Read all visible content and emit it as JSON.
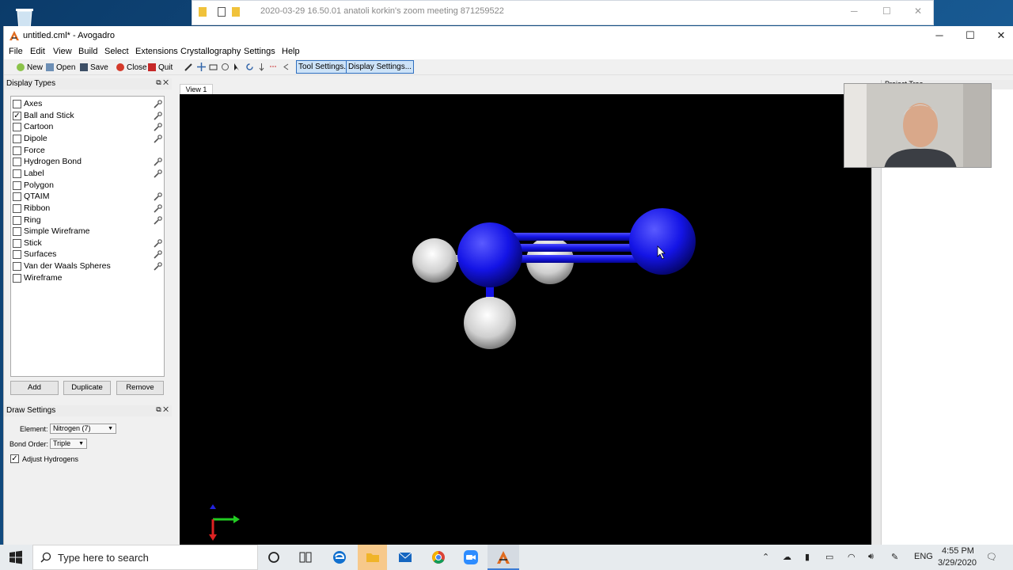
{
  "background_window": {
    "title": "2020-03-29 16.50.01 anatoli korkin's zoom meeting 871259522"
  },
  "app": {
    "title": "untitled.cml* - Avogadro",
    "menu": [
      "File",
      "Edit",
      "View",
      "Build",
      "Select",
      "Extensions",
      "Crystallography",
      "Settings",
      "Help"
    ],
    "toolbar": {
      "new": "New",
      "open": "Open",
      "save": "Save",
      "close": "Close",
      "quit": "Quit",
      "tool_settings": "Tool Settings...",
      "display_settings": "Display Settings..."
    }
  },
  "display_types": {
    "title": "Display Types",
    "items": [
      {
        "label": "Axes",
        "checked": false
      },
      {
        "label": "Ball and Stick",
        "checked": true
      },
      {
        "label": "Cartoon",
        "checked": false
      },
      {
        "label": "Dipole",
        "checked": false
      },
      {
        "label": "Force",
        "checked": false
      },
      {
        "label": "Hydrogen Bond",
        "checked": false
      },
      {
        "label": "Label",
        "checked": false
      },
      {
        "label": "Polygon",
        "checked": false
      },
      {
        "label": "QTAIM",
        "checked": false
      },
      {
        "label": "Ribbon",
        "checked": false
      },
      {
        "label": "Ring",
        "checked": false
      },
      {
        "label": "Simple Wireframe",
        "checked": false
      },
      {
        "label": "Stick",
        "checked": false
      },
      {
        "label": "Surfaces",
        "checked": false
      },
      {
        "label": "Van der Waals Spheres",
        "checked": false
      },
      {
        "label": "Wireframe",
        "checked": false
      }
    ],
    "buttons": {
      "add": "Add",
      "duplicate": "Duplicate",
      "remove": "Remove"
    }
  },
  "draw_settings": {
    "title": "Draw Settings",
    "element_label": "Element:",
    "element_value": "Nitrogen (7)",
    "bond_order_label": "Bond Order:",
    "bond_order_value": "Triple",
    "adjust_hydrogens_label": "Adjust Hydrogens",
    "adjust_hydrogens_checked": true
  },
  "view": {
    "tab_label": "View 1"
  },
  "project_tree": {
    "title": "Project Tree"
  },
  "taskbar": {
    "search_placeholder": "Type here to search",
    "lang": "ENG",
    "time": "4:55 PM",
    "date": "3/29/2020"
  },
  "colors": {
    "nitrogen": "#1414e6",
    "hydrogen": "#e8e8e8",
    "viewport_bg": "#000000",
    "highlight_button": "#cde3f8"
  }
}
